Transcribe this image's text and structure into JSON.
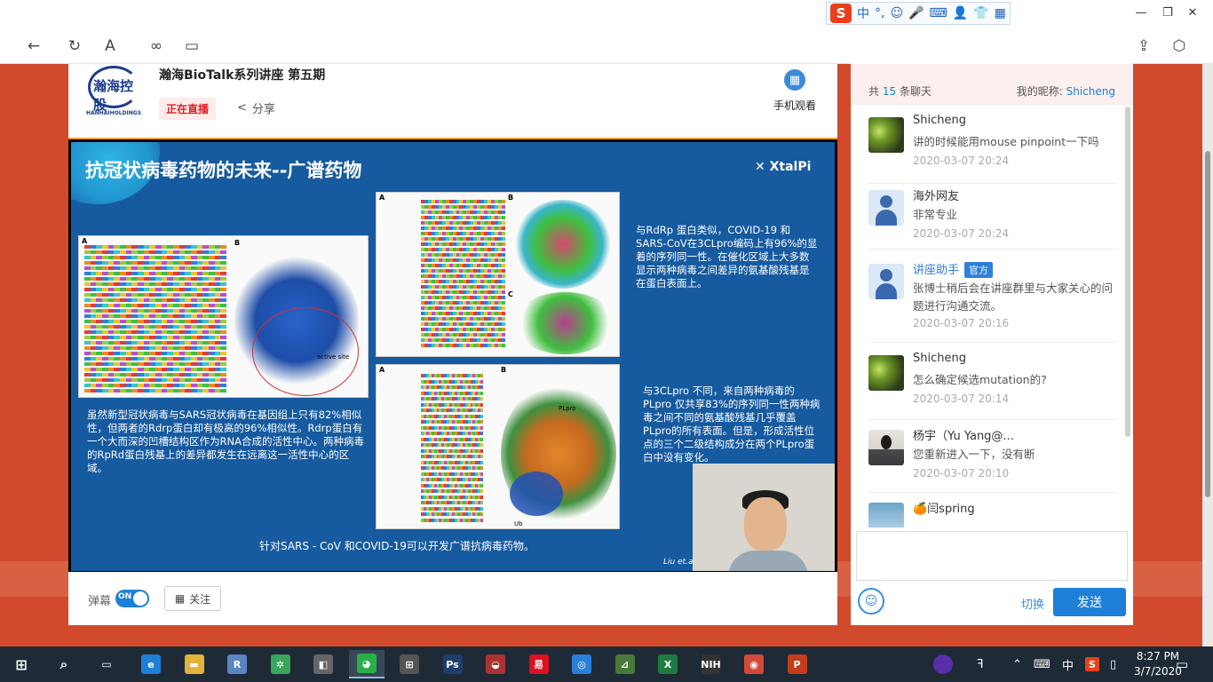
{
  "titlebar": {
    "ime_items": [
      "中",
      "°,",
      "☺",
      "🎤",
      "⌨",
      "👤",
      "👕",
      "▦"
    ],
    "minimize": "—",
    "restore": "❐",
    "close": "✕"
  },
  "toolbar": {
    "back": "←",
    "refresh": "↻",
    "reader": "A",
    "link": "∞",
    "window": "▭",
    "share": "⇪",
    "extension": "⬡"
  },
  "header": {
    "logo_text": "瀚海控股",
    "logo_sub": "HANHAIHOLDINGS",
    "title": "瀚海BioTalk系列讲座 第五期",
    "live_badge": "正在直播",
    "share_label": "分享",
    "mobile_label": "手机观看"
  },
  "slide": {
    "title": "抗冠状病毒药物的未来--广谱药物",
    "brand": "XtalPi",
    "text_left": "虽然新型冠状病毒与SARS冠状病毒在基因组上只有82%相似性，但两者的Rdrp蛋白却有极高的96%相似性。Rdrp蛋白有一个大而深的凹槽结构区作为RNA合成的活性中心。两种病毒的RpRd蛋白残基上的差异都发生在远离这一活性中心的区域。",
    "text_right_top": "与RdRp 蛋白类似，COVID-19 和SARS-CoV在3CLpro编码上有96%的显着的序列同一性。在催化区域上大多数显示两种病毒之间差异的氨基酸残基是在蛋白表面上。",
    "text_right_bottom": "与3CLpro 不同，来自两种病毒的PLpro 仅共享83%的序列同一性两种病毒之间不同的氨基酸残基几乎覆盖PLpro的所有表面。但是，形成活性位点的三个二级结构成分在两个PLpro蛋白中没有变化。",
    "bottom_line": "针对SARS - CoV 和COVID-19可以开发广谱抗病毒药物。",
    "citation": "Liu et.a",
    "fig_labels": [
      "A",
      "B",
      "C",
      "active site",
      "PLpro",
      "Ub"
    ]
  },
  "controls": {
    "danmu_label": "弹幕",
    "toggle_text": "ON",
    "follow_label": "关注"
  },
  "chat": {
    "count_prefix": "共",
    "count": "15",
    "count_suffix": "条聊天",
    "nickname_label": "我的昵称:",
    "nickname": "Shicheng",
    "messages": [
      {
        "name": "Shicheng",
        "text": "讲的时候能用mouse pinpoint一下吗",
        "time": "2020-03-07 20:24"
      },
      {
        "name": "海外网友",
        "text": "非常专业",
        "time": "2020-03-07 20:24"
      },
      {
        "name": "讲座助手",
        "tag": "官方",
        "text": "张博士稍后会在讲座群里与大家关心的问题进行沟通交流。",
        "time": "2020-03-07 20:16"
      },
      {
        "name": "Shicheng",
        "text": "怎么确定候选mutation的?",
        "time": "2020-03-07 20:14"
      },
      {
        "name": "杨宇（Yu Yang@...",
        "text": "您重新进入一下，没有断",
        "time": "2020-03-07 20:10"
      },
      {
        "name": "🍊闫spring",
        "text": "",
        "time": ""
      }
    ],
    "switch_label": "切换",
    "send_label": "发送"
  },
  "taskbar": {
    "time": "8:27 PM",
    "date": "3/7/2020",
    "ime_lang": "中",
    "apps": [
      {
        "name": "edge",
        "label": "e",
        "color": "#1e7fd8"
      },
      {
        "name": "explorer",
        "label": "▬",
        "color": "#e3b33c"
      },
      {
        "name": "r-app",
        "label": "R",
        "color": "#5b84c4"
      },
      {
        "name": "chemdraw",
        "label": "✲",
        "color": "#3aa55c"
      },
      {
        "name": "security",
        "label": "◧",
        "color": "#666"
      },
      {
        "name": "wechat",
        "label": "◕",
        "color": "#2aae4a"
      },
      {
        "name": "store",
        "label": "⊞",
        "color": "#555"
      },
      {
        "name": "photoshop",
        "label": "Ps",
        "color": "#1d3f6e"
      },
      {
        "name": "pymol",
        "label": "◒",
        "color": "#a33"
      },
      {
        "name": "netease",
        "label": "易",
        "color": "#d12"
      },
      {
        "name": "baidu",
        "label": "◎",
        "color": "#2a7fd8"
      },
      {
        "name": "prism",
        "label": "⊿",
        "color": "#4a7a3a"
      },
      {
        "name": "excel",
        "label": "X",
        "color": "#1f7a40"
      },
      {
        "name": "nih",
        "label": "NIH",
        "color": "#333"
      },
      {
        "name": "chrome",
        "label": "◉",
        "color": "#d34a3a"
      },
      {
        "name": "powerpoint",
        "label": "P",
        "color": "#c43e1c"
      }
    ]
  }
}
